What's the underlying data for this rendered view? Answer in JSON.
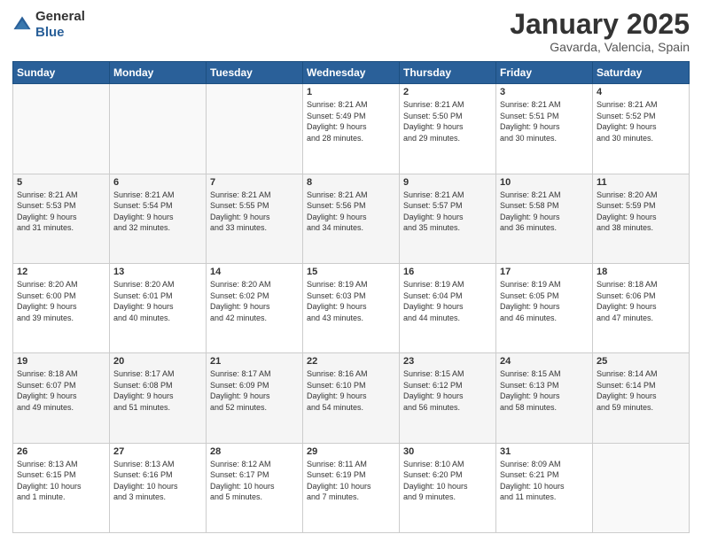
{
  "logo": {
    "general": "General",
    "blue": "Blue"
  },
  "header": {
    "title": "January 2025",
    "subtitle": "Gavarda, Valencia, Spain"
  },
  "days_of_week": [
    "Sunday",
    "Monday",
    "Tuesday",
    "Wednesday",
    "Thursday",
    "Friday",
    "Saturday"
  ],
  "weeks": [
    [
      {
        "day": "",
        "info": ""
      },
      {
        "day": "",
        "info": ""
      },
      {
        "day": "",
        "info": ""
      },
      {
        "day": "1",
        "info": "Sunrise: 8:21 AM\nSunset: 5:49 PM\nDaylight: 9 hours\nand 28 minutes."
      },
      {
        "day": "2",
        "info": "Sunrise: 8:21 AM\nSunset: 5:50 PM\nDaylight: 9 hours\nand 29 minutes."
      },
      {
        "day": "3",
        "info": "Sunrise: 8:21 AM\nSunset: 5:51 PM\nDaylight: 9 hours\nand 30 minutes."
      },
      {
        "day": "4",
        "info": "Sunrise: 8:21 AM\nSunset: 5:52 PM\nDaylight: 9 hours\nand 30 minutes."
      }
    ],
    [
      {
        "day": "5",
        "info": "Sunrise: 8:21 AM\nSunset: 5:53 PM\nDaylight: 9 hours\nand 31 minutes."
      },
      {
        "day": "6",
        "info": "Sunrise: 8:21 AM\nSunset: 5:54 PM\nDaylight: 9 hours\nand 32 minutes."
      },
      {
        "day": "7",
        "info": "Sunrise: 8:21 AM\nSunset: 5:55 PM\nDaylight: 9 hours\nand 33 minutes."
      },
      {
        "day": "8",
        "info": "Sunrise: 8:21 AM\nSunset: 5:56 PM\nDaylight: 9 hours\nand 34 minutes."
      },
      {
        "day": "9",
        "info": "Sunrise: 8:21 AM\nSunset: 5:57 PM\nDaylight: 9 hours\nand 35 minutes."
      },
      {
        "day": "10",
        "info": "Sunrise: 8:21 AM\nSunset: 5:58 PM\nDaylight: 9 hours\nand 36 minutes."
      },
      {
        "day": "11",
        "info": "Sunrise: 8:20 AM\nSunset: 5:59 PM\nDaylight: 9 hours\nand 38 minutes."
      }
    ],
    [
      {
        "day": "12",
        "info": "Sunrise: 8:20 AM\nSunset: 6:00 PM\nDaylight: 9 hours\nand 39 minutes."
      },
      {
        "day": "13",
        "info": "Sunrise: 8:20 AM\nSunset: 6:01 PM\nDaylight: 9 hours\nand 40 minutes."
      },
      {
        "day": "14",
        "info": "Sunrise: 8:20 AM\nSunset: 6:02 PM\nDaylight: 9 hours\nand 42 minutes."
      },
      {
        "day": "15",
        "info": "Sunrise: 8:19 AM\nSunset: 6:03 PM\nDaylight: 9 hours\nand 43 minutes."
      },
      {
        "day": "16",
        "info": "Sunrise: 8:19 AM\nSunset: 6:04 PM\nDaylight: 9 hours\nand 44 minutes."
      },
      {
        "day": "17",
        "info": "Sunrise: 8:19 AM\nSunset: 6:05 PM\nDaylight: 9 hours\nand 46 minutes."
      },
      {
        "day": "18",
        "info": "Sunrise: 8:18 AM\nSunset: 6:06 PM\nDaylight: 9 hours\nand 47 minutes."
      }
    ],
    [
      {
        "day": "19",
        "info": "Sunrise: 8:18 AM\nSunset: 6:07 PM\nDaylight: 9 hours\nand 49 minutes."
      },
      {
        "day": "20",
        "info": "Sunrise: 8:17 AM\nSunset: 6:08 PM\nDaylight: 9 hours\nand 51 minutes."
      },
      {
        "day": "21",
        "info": "Sunrise: 8:17 AM\nSunset: 6:09 PM\nDaylight: 9 hours\nand 52 minutes."
      },
      {
        "day": "22",
        "info": "Sunrise: 8:16 AM\nSunset: 6:10 PM\nDaylight: 9 hours\nand 54 minutes."
      },
      {
        "day": "23",
        "info": "Sunrise: 8:15 AM\nSunset: 6:12 PM\nDaylight: 9 hours\nand 56 minutes."
      },
      {
        "day": "24",
        "info": "Sunrise: 8:15 AM\nSunset: 6:13 PM\nDaylight: 9 hours\nand 58 minutes."
      },
      {
        "day": "25",
        "info": "Sunrise: 8:14 AM\nSunset: 6:14 PM\nDaylight: 9 hours\nand 59 minutes."
      }
    ],
    [
      {
        "day": "26",
        "info": "Sunrise: 8:13 AM\nSunset: 6:15 PM\nDaylight: 10 hours\nand 1 minute."
      },
      {
        "day": "27",
        "info": "Sunrise: 8:13 AM\nSunset: 6:16 PM\nDaylight: 10 hours\nand 3 minutes."
      },
      {
        "day": "28",
        "info": "Sunrise: 8:12 AM\nSunset: 6:17 PM\nDaylight: 10 hours\nand 5 minutes."
      },
      {
        "day": "29",
        "info": "Sunrise: 8:11 AM\nSunset: 6:19 PM\nDaylight: 10 hours\nand 7 minutes."
      },
      {
        "day": "30",
        "info": "Sunrise: 8:10 AM\nSunset: 6:20 PM\nDaylight: 10 hours\nand 9 minutes."
      },
      {
        "day": "31",
        "info": "Sunrise: 8:09 AM\nSunset: 6:21 PM\nDaylight: 10 hours\nand 11 minutes."
      },
      {
        "day": "",
        "info": ""
      }
    ]
  ]
}
